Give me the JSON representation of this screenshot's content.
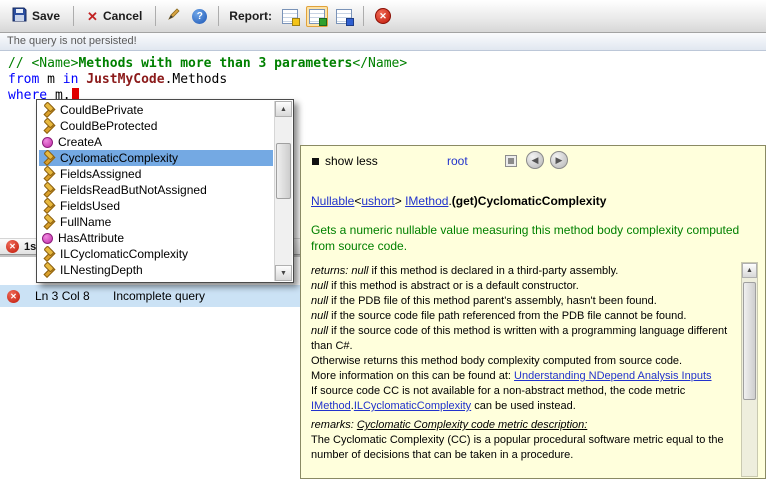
{
  "colors": {
    "keyword": "#0000ff",
    "comment": "#008000",
    "type_ref": "#8b1a1a",
    "link": "#2233cc",
    "summary": "#008000",
    "selection_bg": "#74a9e3",
    "tooltip_bg": "#ffffdc",
    "error_row_bg": "#cbe2f5",
    "caret": "#e00000",
    "report_yellow": "#f3c318",
    "report_green": "#2fa12f",
    "report_blue": "#2f5fd0"
  },
  "toolbar": {
    "save": "Save",
    "cancel": "Cancel",
    "cancel_x": "✕",
    "help": "?",
    "report": "Report:",
    "delete_x": "✕"
  },
  "infobar": {
    "message": "The query is not persisted!"
  },
  "editor": {
    "lines": [
      {
        "tokens": [
          {
            "t": "// <Name>",
            "s": "comment"
          },
          {
            "t": "Methods with more than 3 parameters",
            "s": "comment-bold"
          },
          {
            "t": "</Name>",
            "s": "comment"
          }
        ]
      },
      {
        "tokens": [
          {
            "t": "from",
            "s": "keyword"
          },
          {
            "t": " m ",
            "s": "plain"
          },
          {
            "t": "in",
            "s": "keyword"
          },
          {
            "t": " ",
            "s": "plain"
          },
          {
            "t": "JustMyCode",
            "s": "type"
          },
          {
            "t": ".Methods",
            "s": "plain"
          }
        ]
      },
      {
        "tokens": [
          {
            "t": "where",
            "s": "keyword"
          },
          {
            "t": " m",
            "s": "plain"
          },
          {
            "t": ".",
            "s": "plain"
          }
        ],
        "caret": true
      }
    ]
  },
  "status_strip": {
    "badge_icon": "error",
    "badge_text": "1s"
  },
  "error_list": {
    "rows": [
      {
        "location": "Ln 3 Col 8",
        "message": "Incomplete query"
      }
    ]
  },
  "intellisense": {
    "selected_index": 3,
    "items": [
      {
        "label": "CouldBePrivate",
        "icon": "property-icon"
      },
      {
        "label": "CouldBeProtected",
        "icon": "property-icon"
      },
      {
        "label": "CreateA",
        "icon": "method-icon"
      },
      {
        "label": "CyclomaticComplexity",
        "icon": "property-icon"
      },
      {
        "label": "FieldsAssigned",
        "icon": "property-icon"
      },
      {
        "label": "FieldsReadButNotAssigned",
        "icon": "property-icon"
      },
      {
        "label": "FieldsUsed",
        "icon": "property-icon"
      },
      {
        "label": "FullName",
        "icon": "property-icon"
      },
      {
        "label": "HasAttribute",
        "icon": "method-icon"
      },
      {
        "label": "ILCyclomaticComplexity",
        "icon": "property-icon"
      },
      {
        "label": "ILNestingDepth",
        "icon": "property-icon"
      }
    ]
  },
  "doc_popup": {
    "show_less": "show less",
    "root": "root",
    "nav_back": "◀",
    "nav_fwd": "▶",
    "signature": [
      {
        "t": "Nullable",
        "s": "link"
      },
      {
        "t": "<",
        "s": "plain"
      },
      {
        "t": "ushort",
        "s": "link"
      },
      {
        "t": "> ",
        "s": "plain"
      },
      {
        "t": "IMethod",
        "s": "link"
      },
      {
        "t": ".",
        "s": "plain"
      },
      {
        "t": "(get)CyclomaticComplexity",
        "s": "bold"
      }
    ],
    "summary": "Gets a numeric nullable value measuring this method body complexity computed from source code.",
    "paragraphs": [
      {
        "parts": [
          {
            "t": "returns: ",
            "s": "italic"
          },
          {
            "t": "null",
            "s": "italic"
          },
          {
            "t": " if this method is declared in a third-party assembly.",
            "s": "plain"
          }
        ]
      },
      {
        "parts": [
          {
            "t": "null",
            "s": "italic"
          },
          {
            "t": " if this method is abstract or is a default constructor.",
            "s": "plain"
          }
        ]
      },
      {
        "parts": [
          {
            "t": "null",
            "s": "italic"
          },
          {
            "t": " if the PDB file of this method parent's assembly, hasn't been found.",
            "s": "plain"
          }
        ]
      },
      {
        "parts": [
          {
            "t": "null",
            "s": "italic"
          },
          {
            "t": " if the source code file path referenced from the PDB file cannot be found.",
            "s": "plain"
          }
        ]
      },
      {
        "parts": [
          {
            "t": "null",
            "s": "italic"
          },
          {
            "t": " if the source code of this method is written with a programming language different than C#.",
            "s": "plain"
          }
        ]
      },
      {
        "parts": [
          {
            "t": "Otherwise returns this method body complexity computed from source code.",
            "s": "plain"
          }
        ]
      },
      {
        "parts": [
          {
            "t": "More information on this can be found at: ",
            "s": "plain"
          },
          {
            "t": "Understanding NDepend Analysis Inputs",
            "s": "link"
          }
        ]
      },
      {
        "parts": [
          {
            "t": "If source code CC is not available for a non-abstract method, the code metric ",
            "s": "plain"
          },
          {
            "t": "IMethod",
            "s": "link"
          },
          {
            "t": ".",
            "s": "plain"
          },
          {
            "t": "ILCyclomaticComplexity",
            "s": "link"
          },
          {
            "t": " can be used instead.",
            "s": "plain"
          }
        ]
      },
      {
        "spaced": true,
        "parts": [
          {
            "t": "remarks: ",
            "s": "italic"
          },
          {
            "t": "Cyclomatic Complexity code metric description:",
            "s": "underline-italic"
          }
        ]
      },
      {
        "parts": [
          {
            "t": "The Cyclomatic Complexity (CC) is a popular procedural software metric equal to the number of decisions that can be taken in a procedure.",
            "s": "plain"
          }
        ]
      }
    ]
  }
}
